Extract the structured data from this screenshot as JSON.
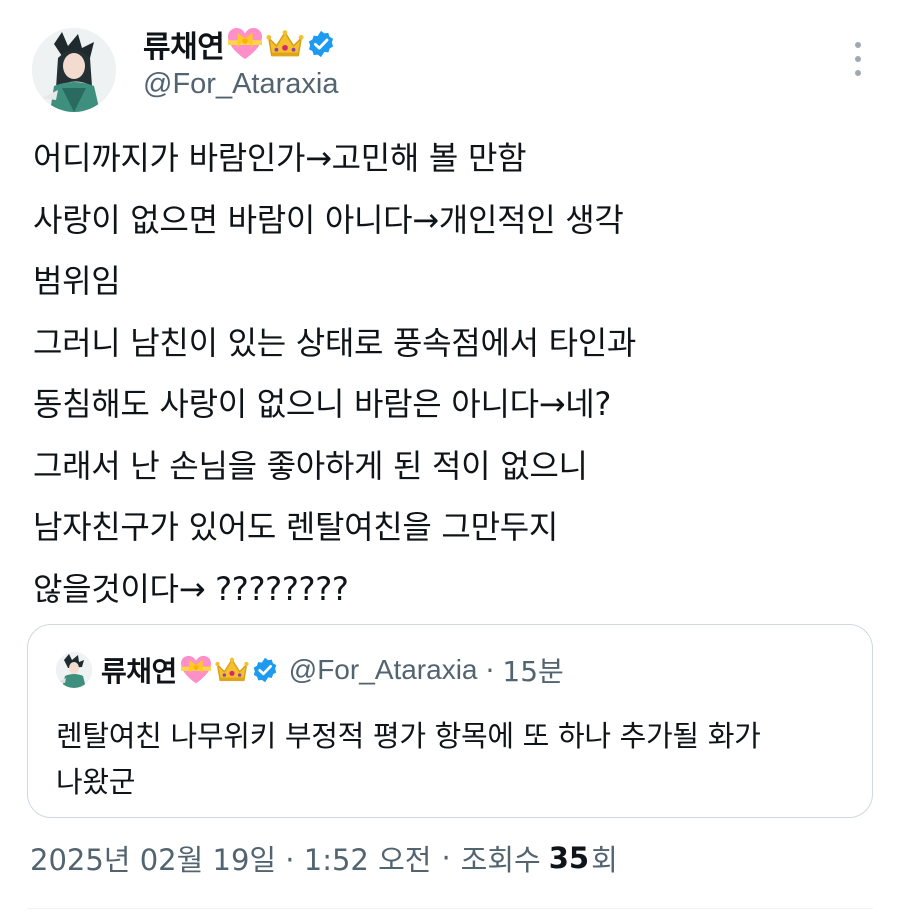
{
  "colors": {
    "text": "#0f1419",
    "secondary": "#536471",
    "verified": "#1d9bf0",
    "border": "#cfd9de"
  },
  "tweet": {
    "author": {
      "name": "류채연",
      "handle": "@For_Ataraxia",
      "badges": [
        "heart-with-ribbon-icon",
        "crown-icon",
        "verified-badge-icon"
      ]
    },
    "lines": [
      "어디까지가 바람인가→고민해 볼 만함",
      "사랑이 없으면 바람이 아니다→개인적인 생각",
      "범위임",
      "그러니 남친이 있는 상태로 풍속점에서 타인과",
      "동침해도 사랑이 없으니 바람은 아니다→네?",
      "그래서 난 손님을 좋아하게 된 적이 없으니",
      "남자친구가 있어도 렌탈여친을 그만두지",
      "않을것이다→ ????????"
    ],
    "timestamp": "2025년 02월 19일 · 1:52 오전",
    "separator": "·",
    "views_label": "조회수",
    "views_count": "35",
    "views_unit": "회"
  },
  "quote": {
    "name": "류채연",
    "handle": "@For_Ataraxia",
    "dot": "·",
    "time": "15분",
    "lines": [
      "렌탈여친 나무위키 부정적 평가 항목에 또 하나 추가될 화가",
      "나왔군"
    ]
  }
}
